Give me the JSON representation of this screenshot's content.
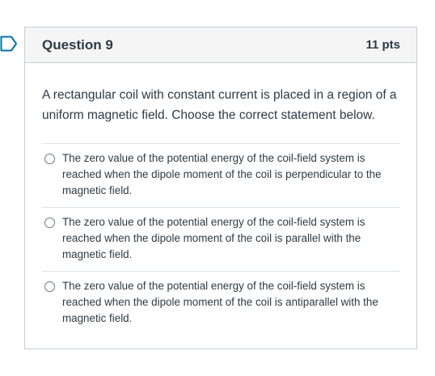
{
  "question": {
    "title": "Question 9",
    "points": "11 pts",
    "text": "A rectangular coil with constant current is placed in a region of a uniform magnetic field. Choose the correct statement below."
  },
  "answers": [
    {
      "label": "The zero value of the potential energy of the coil-field system is reached when the dipole moment of the coil is perpendicular to the magnetic field."
    },
    {
      "label": "The zero value of the potential energy of the coil-field system is reached when the dipole moment of the coil is parallel with the magnetic field."
    },
    {
      "label": "The zero value of the potential energy of the coil-field system is reached when the dipole moment of the coil is antiparallel with the magnetic field."
    }
  ],
  "icons": {
    "flag": "bookmark-flag-icon",
    "radio": "radio-button-icon"
  },
  "colors": {
    "accent": "#0770a3",
    "header_bg": "#f5f5f5",
    "border": "#c7cdd1",
    "text": "#2d3b45"
  }
}
